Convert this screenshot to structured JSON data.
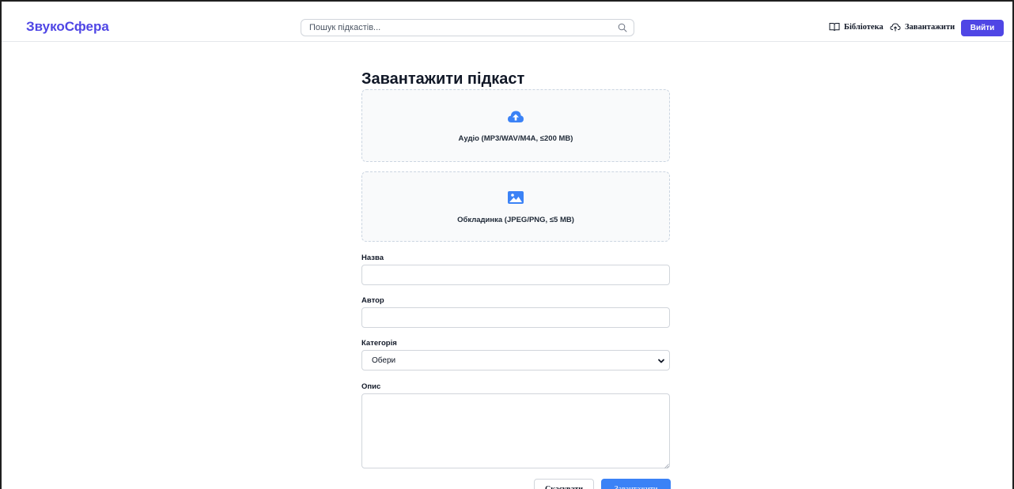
{
  "header": {
    "brand": "ЗвукоСфера",
    "search_placeholder": "Пошук підкастів...",
    "search_icon": "search-icon",
    "nav": {
      "library_label": "Бібліотека",
      "library_icon": "book-open-icon",
      "upload_label": "Завантажити",
      "upload_icon": "cloud-upload-icon"
    },
    "logout_label": "Вийти"
  },
  "form": {
    "title": "Завантажити підкаст",
    "audio_drop": {
      "icon": "cloud-upload-icon",
      "label": "Аудіо (MP3/WAV/M4A, ≤200 MB)"
    },
    "cover_drop": {
      "icon": "image-icon",
      "label": "Обкладинка (JPEG/PNG, ≤5 MB)"
    },
    "fields": {
      "title_label": "Назва",
      "title_value": "",
      "author_label": "Автор",
      "author_value": "",
      "category_label": "Категорія",
      "category_selected": "Обери",
      "description_label": "Опис",
      "description_value": ""
    },
    "actions": {
      "cancel_label": "Скасувати",
      "submit_label": "Завантажити"
    }
  },
  "colors": {
    "brand": "#4f46e5",
    "primary": "#3b82f6",
    "dropzone_bg": "#f9fafb",
    "border": "#d1d5db"
  }
}
